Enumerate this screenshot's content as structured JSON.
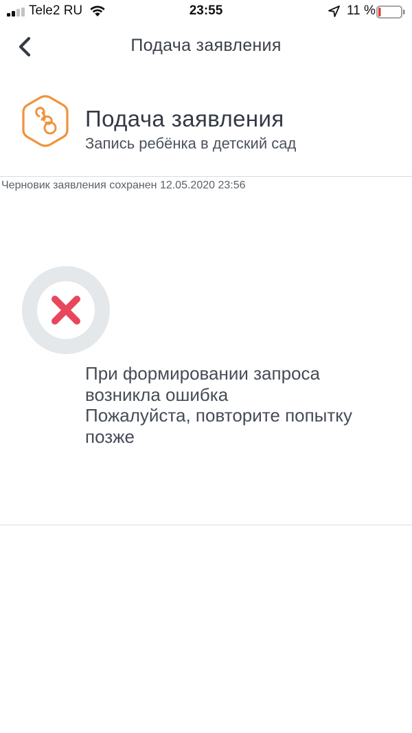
{
  "status_bar": {
    "carrier": "Tele2 RU",
    "time": "23:55",
    "battery_percent": "11 %",
    "battery_level": 0.11,
    "signal_bars": 2,
    "signal_bars_total": 4,
    "icons": [
      "signal-icon",
      "wifi-icon",
      "location-arrow-icon",
      "battery-icon"
    ]
  },
  "nav": {
    "title": "Подача заявления",
    "back_icon": "chevron-left-icon"
  },
  "service": {
    "icon": "pacifier-icon",
    "title": "Подача заявления",
    "subtitle": "Запись ребёнка в детский сад"
  },
  "draft_note": "Черновик заявления сохранен 12.05.2020 23:56",
  "error": {
    "icon": "error-cross-icon",
    "lines": [
      "При формировании запроса",
      "возникла ошибка",
      "Пожалуйста, повторите попытку",
      "позже"
    ]
  },
  "colors": {
    "accent_orange": "#f0923a",
    "error_red": "#e8475b",
    "ring_gray": "#e4e8eb",
    "divider": "#d5dadf",
    "battery_low": "#e53935"
  }
}
